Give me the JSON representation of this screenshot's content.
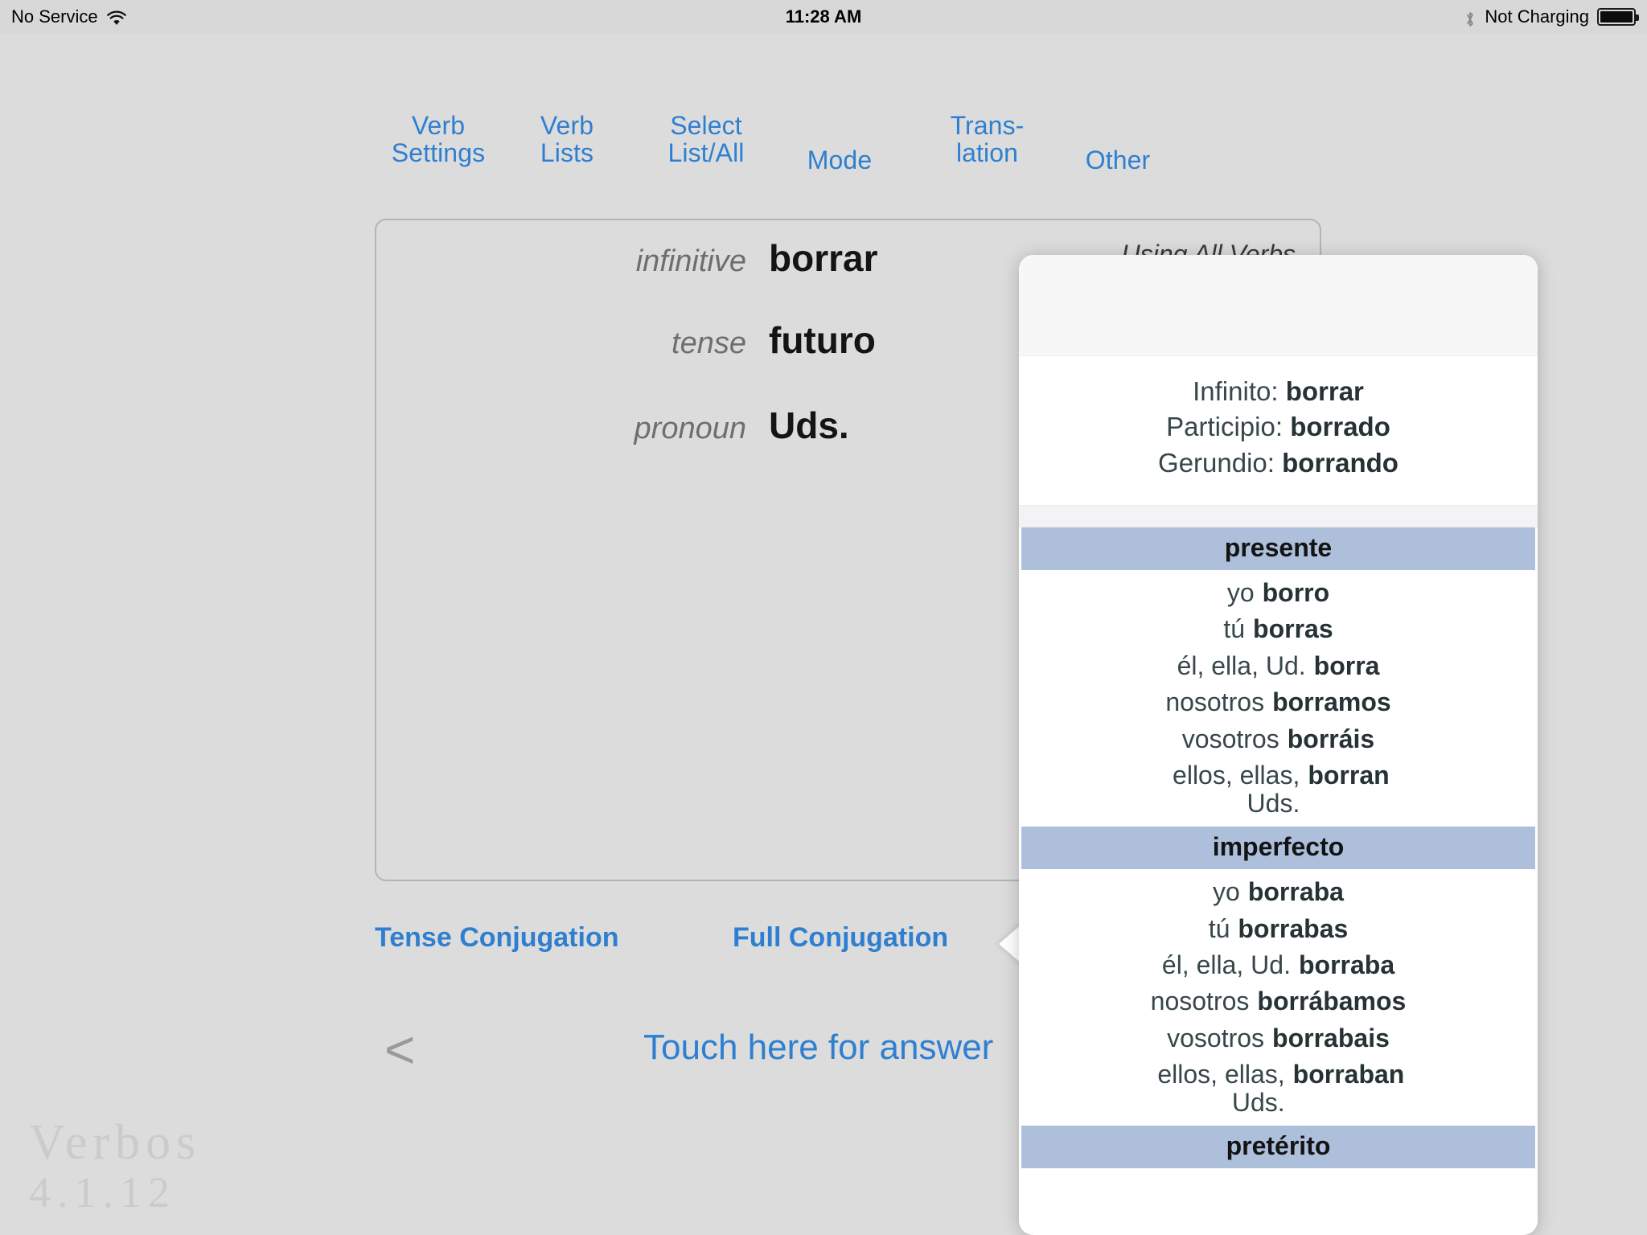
{
  "status_bar": {
    "carrier": "No Service",
    "wifi_icon": "wifi-icon",
    "time": "11:28 AM",
    "bluetooth_icon": "bluetooth-icon",
    "charging_status": "Not Charging",
    "battery_icon": "battery-full-icon"
  },
  "top_menu": [
    {
      "line1": "Verb",
      "line2": "Settings"
    },
    {
      "line1": "Verb",
      "line2": "Lists"
    },
    {
      "line1": "Select",
      "line2": "List/All"
    },
    {
      "line1": "Mode",
      "line2": ""
    },
    {
      "line1": "Trans-",
      "line2": "lation"
    },
    {
      "line1": "Other",
      "line2": ""
    }
  ],
  "card": {
    "using_label": "Using All Verbs",
    "rows": [
      {
        "label": "infinitive",
        "value": "borrar"
      },
      {
        "label": "tense",
        "value": "futuro"
      },
      {
        "label": "pronoun",
        "value": "Uds."
      }
    ]
  },
  "actions": {
    "tense_conjugation": "Tense Conjugation",
    "full_conjugation": "Full Conjugation",
    "touch_for_answer": "Touch here for answer",
    "back_chevron": "<"
  },
  "watermark": {
    "title": "Verbos",
    "version": "4.1.12"
  },
  "popover": {
    "header": {
      "infinitive_label": "Infinito:",
      "infinitive_value": "borrar",
      "participle_label": "Participio:",
      "participle_value": "borrado",
      "gerund_label": "Gerundio:",
      "gerund_value": "borrando"
    },
    "sections": [
      {
        "tense": "presente",
        "rows": [
          {
            "pronoun": "yo",
            "form": "borro"
          },
          {
            "pronoun": "tú",
            "form": "borras"
          },
          {
            "pronoun": "él, ella, Ud.",
            "form": "borra"
          },
          {
            "pronoun": "nosotros",
            "form": "borramos"
          },
          {
            "pronoun": "vosotros",
            "form": "borráis"
          },
          {
            "pronoun": "ellos, ellas, Uds.",
            "form": "borran"
          }
        ]
      },
      {
        "tense": "imperfecto",
        "rows": [
          {
            "pronoun": "yo",
            "form": "borraba"
          },
          {
            "pronoun": "tú",
            "form": "borrabas"
          },
          {
            "pronoun": "él, ella, Ud.",
            "form": "borraba"
          },
          {
            "pronoun": "nosotros",
            "form": "borrábamos"
          },
          {
            "pronoun": "vosotros",
            "form": "borrabais"
          },
          {
            "pronoun": "ellos, ellas, Uds.",
            "form": "borraban"
          }
        ]
      },
      {
        "tense": "pretérito",
        "rows": []
      }
    ]
  },
  "colors": {
    "accent_blue": "#2f7fd1",
    "tense_header_bg": "#adbfdb",
    "page_bg": "#dcdcdc",
    "text_dark": "#37474a"
  }
}
